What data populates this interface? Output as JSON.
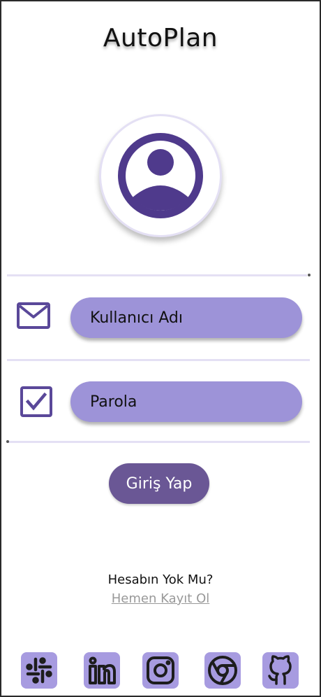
{
  "app": {
    "title": "AutoPlan"
  },
  "form": {
    "username_placeholder": "Kullanıcı Adı",
    "password_placeholder": "Parola",
    "login_label": "Giriş Yap"
  },
  "signup": {
    "question": "Hesabın Yok Mu?",
    "link_label": "Hemen Kayıt Ol"
  },
  "icons": {
    "avatar": "user-avatar-icon",
    "username": "mail-icon",
    "password": "checkbox-icon",
    "social": [
      "slack-icon",
      "linkedin-icon",
      "instagram-icon",
      "chrome-icon",
      "github-icon"
    ]
  },
  "colors": {
    "accent": "#6a5795",
    "field": "#9d93d8",
    "divider": "#e4e0f4",
    "social_bg": "#a79be0",
    "icon_purple": "#5a4899"
  }
}
